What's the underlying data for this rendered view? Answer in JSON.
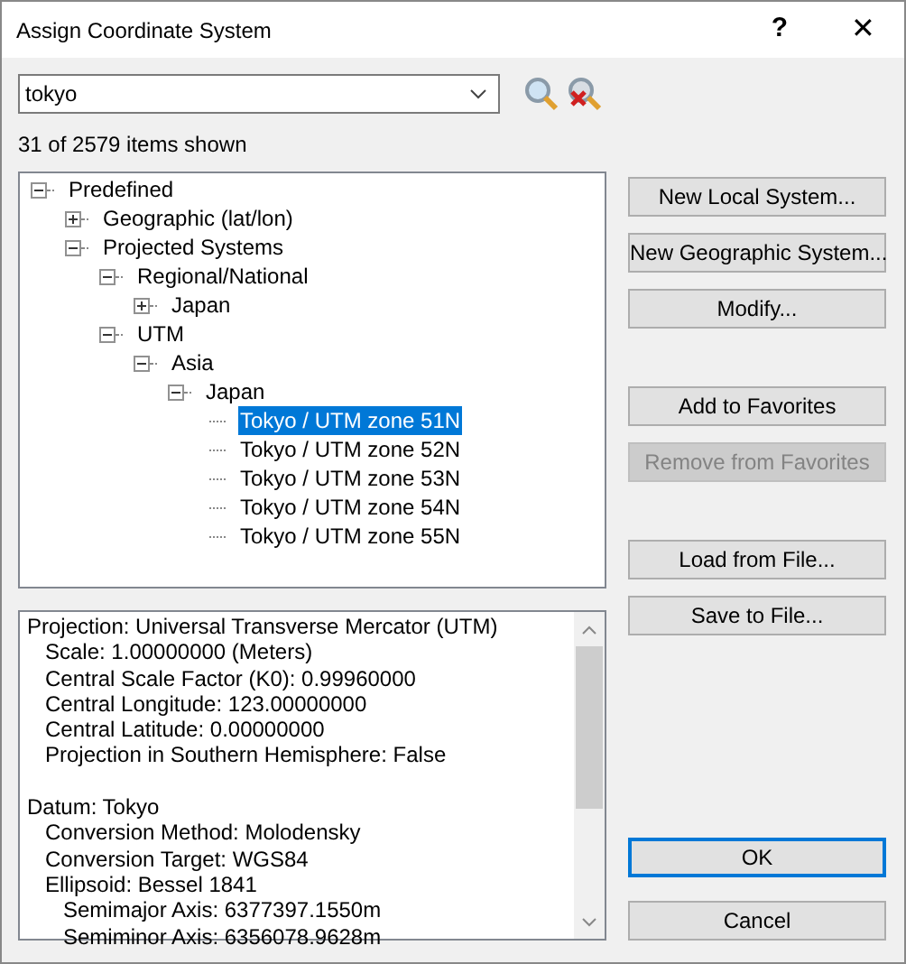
{
  "window": {
    "title": "Assign Coordinate System",
    "help": "?",
    "close": "✕"
  },
  "search": {
    "value": "tokyo"
  },
  "count": "31 of 2579 items shown",
  "tree": [
    {
      "label": "Predefined",
      "expanded": true,
      "selected": false,
      "children": [
        {
          "label": "Geographic (lat/lon)",
          "expanded": false,
          "selected": false
        },
        {
          "label": "Projected Systems",
          "expanded": true,
          "selected": false,
          "children": [
            {
              "label": "Regional/National",
              "expanded": true,
              "selected": false,
              "children": [
                {
                  "label": "Japan",
                  "expanded": false,
                  "selected": false
                }
              ]
            },
            {
              "label": "UTM",
              "expanded": true,
              "selected": false,
              "children": [
                {
                  "label": "Asia",
                  "expanded": true,
                  "selected": false,
                  "children": [
                    {
                      "label": "Japan",
                      "expanded": true,
                      "selected": false,
                      "children": [
                        {
                          "label": "Tokyo / UTM zone 51N",
                          "selected": true
                        },
                        {
                          "label": "Tokyo / UTM zone 52N",
                          "selected": false
                        },
                        {
                          "label": "Tokyo / UTM zone 53N",
                          "selected": false
                        },
                        {
                          "label": "Tokyo / UTM zone 54N",
                          "selected": false
                        },
                        {
                          "label": "Tokyo / UTM zone 55N",
                          "selected": false
                        }
                      ]
                    }
                  ]
                }
              ]
            }
          ]
        }
      ]
    }
  ],
  "details": [
    {
      "text": "Projection: Universal Transverse Mercator (UTM)",
      "children": [
        {
          "text": "Scale: 1.00000000 (Meters)"
        },
        {
          "text": "Central Scale Factor (K0): 0.99960000"
        },
        {
          "text": "Central Longitude: 123.00000000"
        },
        {
          "text": "Central Latitude: 0.00000000"
        },
        {
          "text": "Projection in Southern Hemisphere: False"
        }
      ]
    },
    {
      "text": "Datum: Tokyo",
      "children": [
        {
          "text": "Conversion Method: Molodensky"
        },
        {
          "text": "Conversion Target: WGS84"
        },
        {
          "text": "Ellipsoid: Bessel 1841",
          "children": [
            {
              "text": "Semimajor Axis: 6377397.1550m"
            },
            {
              "text": "Semiminor Axis: 6356078.9628m"
            }
          ]
        }
      ]
    }
  ],
  "button_groups": [
    [
      {
        "label": "New Local System...",
        "disabled": false
      },
      {
        "label": "New Geographic System...",
        "disabled": false
      },
      {
        "label": "Modify...",
        "disabled": false
      }
    ],
    [
      {
        "label": "Add to Favorites",
        "disabled": false
      },
      {
        "label": "Remove from Favorites",
        "disabled": true
      }
    ],
    [
      {
        "label": "Load from File...",
        "disabled": false
      },
      {
        "label": "Save to File...",
        "disabled": false
      }
    ]
  ],
  "dialog_buttons": [
    {
      "label": "OK",
      "default": true
    },
    {
      "label": "Cancel",
      "default": false
    }
  ]
}
